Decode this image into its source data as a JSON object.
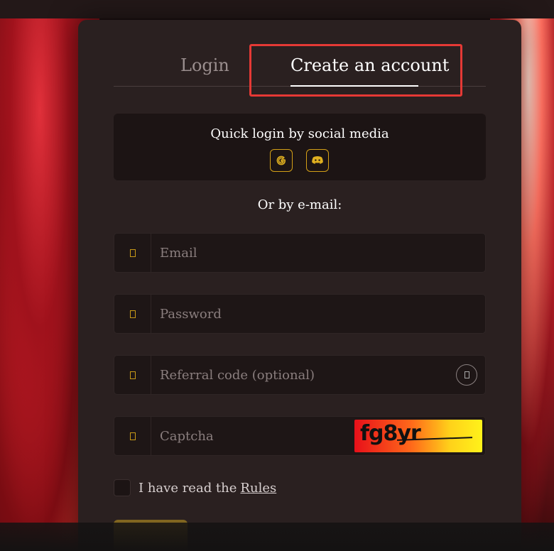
{
  "tabs": {
    "login_label": "Login",
    "create_label": "Create an account"
  },
  "social": {
    "title": "Quick login by social media",
    "google_icon": "google-icon",
    "discord_icon": "discord-icon"
  },
  "or_email_label": "Or by e-mail:",
  "fields": {
    "email_placeholder": "Email",
    "password_placeholder": "Password",
    "referral_placeholder": "Referral code (optional)",
    "captcha_placeholder": "Captcha"
  },
  "captcha_text": "fg8yr",
  "rules": {
    "text": "I have read the",
    "link": "Rules"
  },
  "colors": {
    "accent": "#d4a017",
    "highlight": "#e53935",
    "panel": "#2a2020"
  }
}
